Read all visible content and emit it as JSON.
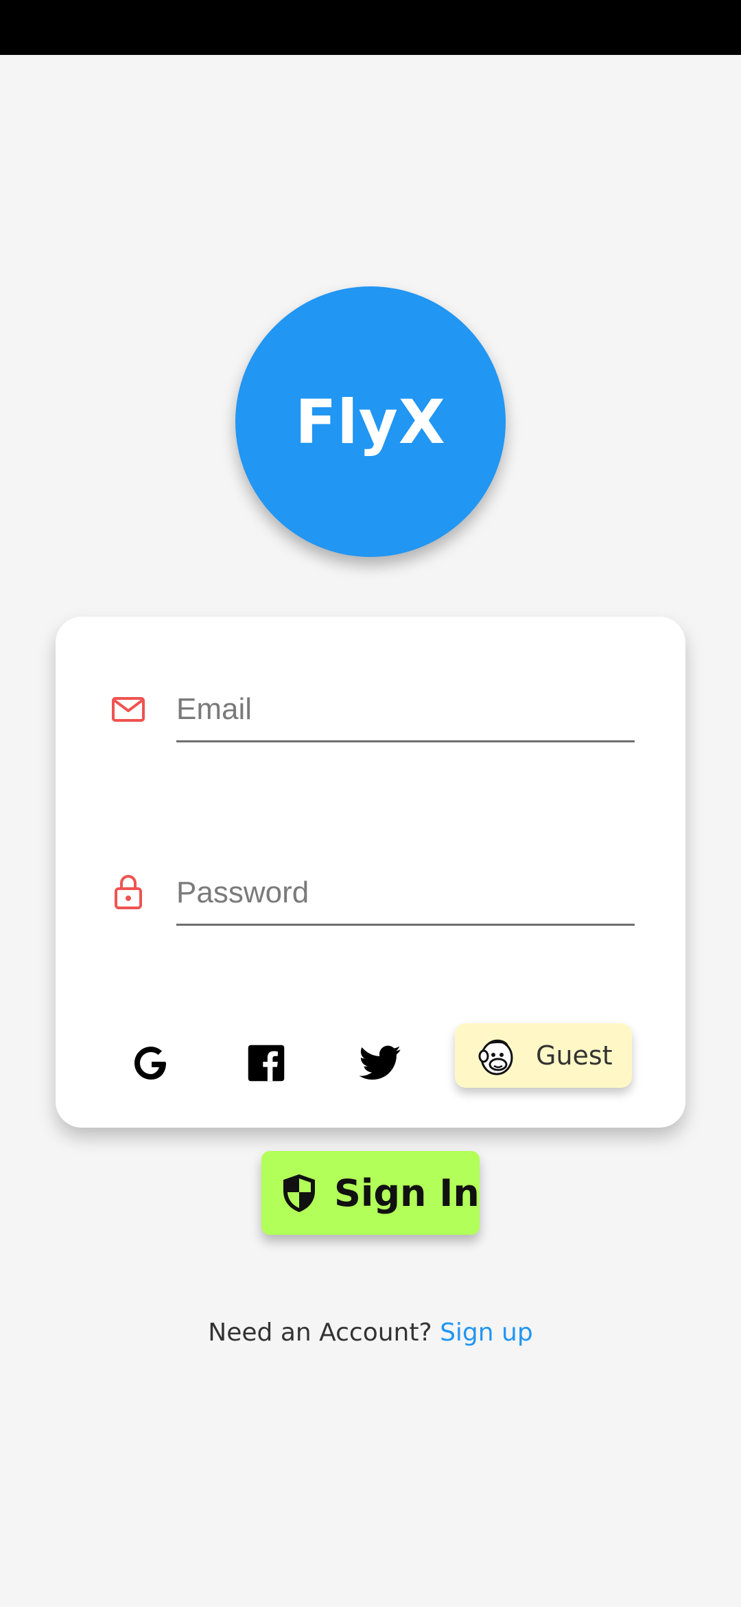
{
  "app": {
    "logo_text": "FlyX"
  },
  "form": {
    "email": {
      "placeholder": "Email",
      "value": "",
      "icon": "mail-icon"
    },
    "password": {
      "placeholder": "Password",
      "value": "",
      "icon": "lock-icon"
    }
  },
  "social": [
    {
      "name": "google",
      "icon": "google-icon"
    },
    {
      "name": "facebook",
      "icon": "facebook-icon"
    },
    {
      "name": "twitter",
      "icon": "twitter-icon"
    }
  ],
  "guest": {
    "label": "Guest",
    "icon": "mailchimp-monkey-icon"
  },
  "signin": {
    "label": "Sign In",
    "icon": "shield-icon"
  },
  "footer": {
    "prompt": "Need an Account?",
    "link": "Sign up"
  },
  "colors": {
    "primary": "#2196f3",
    "accent_icon": "#ef5350",
    "signin_bg": "#b2ff59",
    "guest_bg": "#fff8c6",
    "background": "#f5f5f5"
  }
}
